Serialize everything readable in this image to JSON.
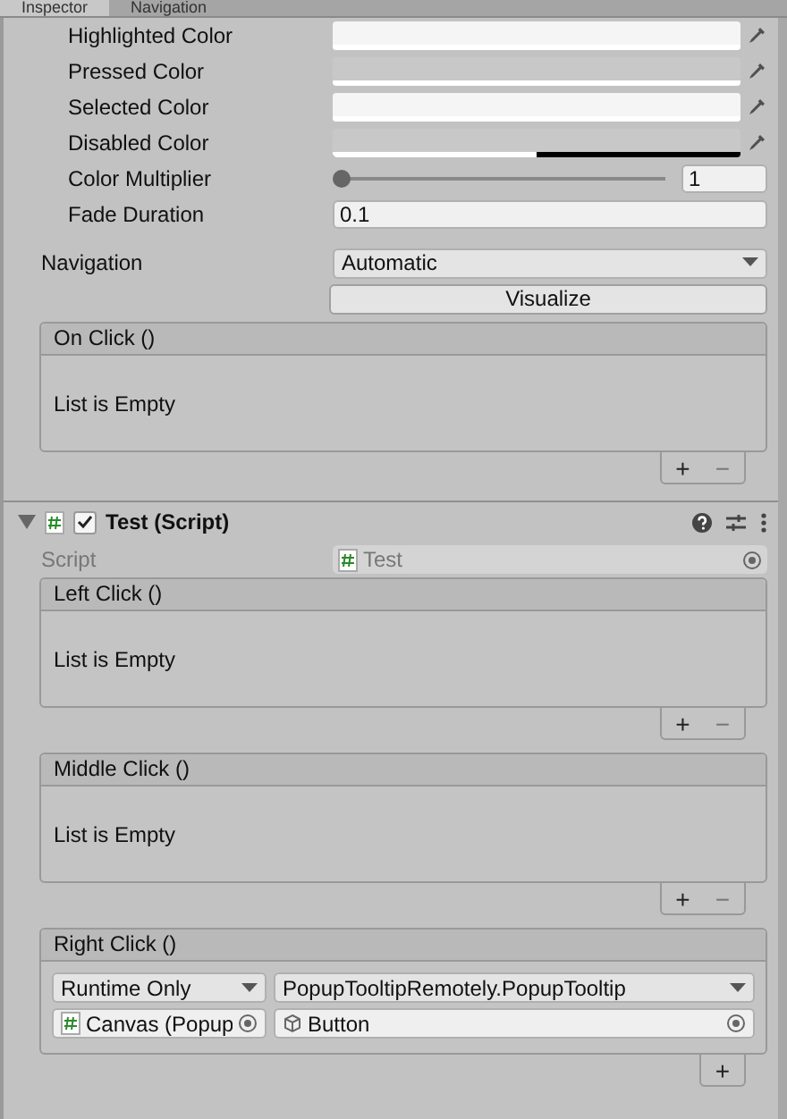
{
  "tabs": [
    {
      "label": "Inspector",
      "selected": true
    },
    {
      "label": "Navigation",
      "selected": false
    }
  ],
  "colors": [
    {
      "label": "Highlighted Color",
      "color": "#f5f5f5",
      "level": 1
    },
    {
      "label": "Pressed Color",
      "color": "#c8c8c8",
      "level": 1
    },
    {
      "label": "Selected Color",
      "color": "#f5f5f5",
      "level": 1
    },
    {
      "label": "Disabled Color",
      "color": "#c8c8c8",
      "level": 0.5
    }
  ],
  "color_multiplier": {
    "label": "Color Multiplier",
    "level": 0,
    "value": "1"
  },
  "fade_duration": {
    "label": "Fade Duration",
    "value": "0.1"
  },
  "navigation": {
    "label": "Navigation",
    "value": "Automatic",
    "button": "Visualize"
  },
  "on_click": {
    "title": "On Click ()",
    "empty_text": "List is Empty",
    "add": "+",
    "remove": "−"
  },
  "component": {
    "title": "Test (Script)",
    "expanded": true,
    "enabled": true,
    "script_label": "Script",
    "script_value": "Test",
    "events": [
      {
        "title": "Left Click ()",
        "empty_text": "List is Empty",
        "add": "+",
        "remove": "−"
      },
      {
        "title": "Middle Click ()",
        "empty_text": "List is Empty",
        "add": "+",
        "remove": "−"
      },
      {
        "title": "Right Click ()",
        "entries": [
          {
            "mode": "Runtime Only",
            "function": "PopupTooltipRemotely.PopupTooltip",
            "target": "Canvas (Popup",
            "argument": "Button"
          }
        ],
        "add": "+"
      }
    ]
  }
}
